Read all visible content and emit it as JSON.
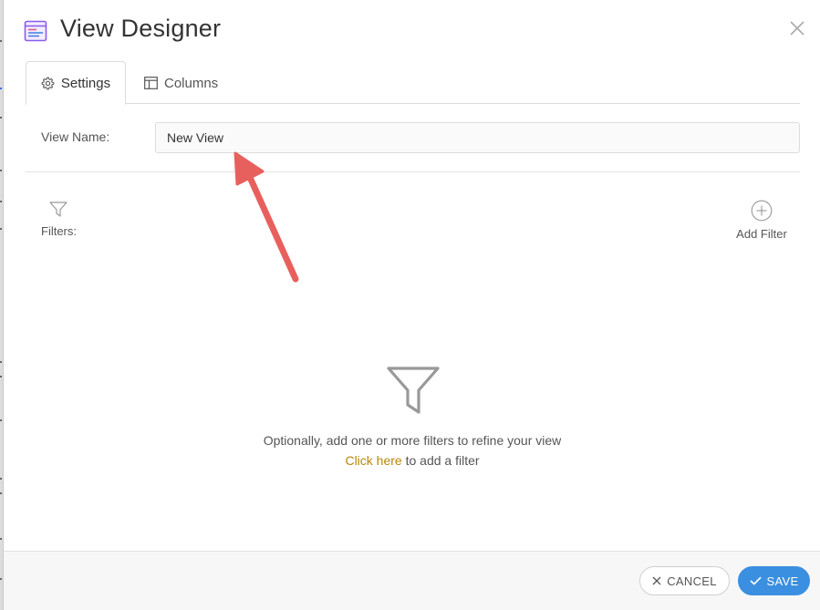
{
  "dialog": {
    "title": "View Designer",
    "icon": "view-designer-icon"
  },
  "tabs": [
    {
      "label": "Settings",
      "icon": "gear-icon",
      "active": true
    },
    {
      "label": "Columns",
      "icon": "columns-icon",
      "active": false
    }
  ],
  "settings": {
    "view_name_label": "View Name:",
    "view_name_value": "New View"
  },
  "filters": {
    "label": "Filters:",
    "add_label": "Add Filter",
    "empty_message": "Optionally, add one or more filters to refine your view",
    "link_text": "Click here",
    "link_suffix": " to add a filter"
  },
  "footer": {
    "cancel_label": "CANCEL",
    "save_label": "SAVE"
  },
  "colors": {
    "accent": "#3b8fe0",
    "link": "#b8860b",
    "annotation_arrow": "#e8605d"
  }
}
